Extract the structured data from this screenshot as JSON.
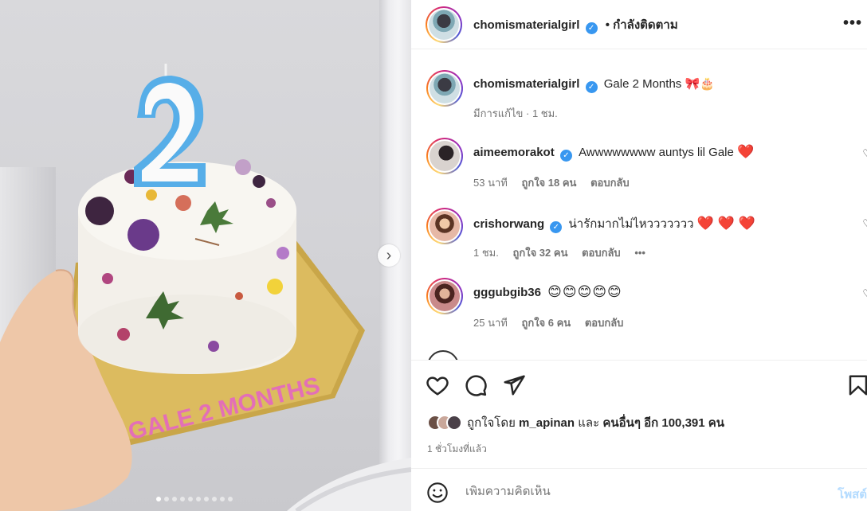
{
  "post": {
    "author": "chomismaterialgirl",
    "follow_status": "• กำลังติดตาม",
    "caption": "Gale 2 Months 🎀🎂",
    "caption_meta": "มีการแก้ไข · 1 ชม.",
    "more_label": "•••"
  },
  "media": {
    "next_label": "›",
    "carousel_count": 10,
    "carousel_active": 0,
    "cake_text": "GALE 2 MONTHS",
    "candle_number": "2"
  },
  "comments": [
    {
      "username": "aimeemorakot",
      "verified": true,
      "text": "Awwwwwwww auntys lil Gale",
      "trailing": "❤️",
      "time": "53 นาที",
      "likes": "ถูกใจ 18 คน",
      "reply": "ตอบกลับ",
      "avatar_color": "#5a4a44"
    },
    {
      "username": "crishorwang",
      "verified": true,
      "text": "น่ารักมากไม่ไหววววววว",
      "trailing": "❤️ ❤️ ❤️",
      "time": "1 ชม.",
      "likes": "ถูกใจ 32 คน",
      "reply": "ตอบกลับ",
      "extra": "•••",
      "avatar_color": "#b77a60"
    },
    {
      "username": "gggubgib36",
      "verified": false,
      "text": "😊😊😊😊😊",
      "trailing": "",
      "time": "25 นาที",
      "likes": "ถูกใจ 6 คน",
      "reply": "ตอบกลับ",
      "avatar_color": "#8a4a44"
    }
  ],
  "likes": {
    "prefix": "ถูกใจโดย",
    "user": "m_apinan",
    "joiner": "และ",
    "others": "คนอื่นๆ อีก 100,391 คน"
  },
  "timestamp": "1 ชั่วโมงที่แล้ว",
  "comment_box": {
    "placeholder": "เพิ่มความคิดเห็น",
    "post_label": "โพสต์"
  },
  "colors": {
    "verified": "#3897f0",
    "heart": "#ed1d26",
    "post_button": "#b3dbff"
  }
}
